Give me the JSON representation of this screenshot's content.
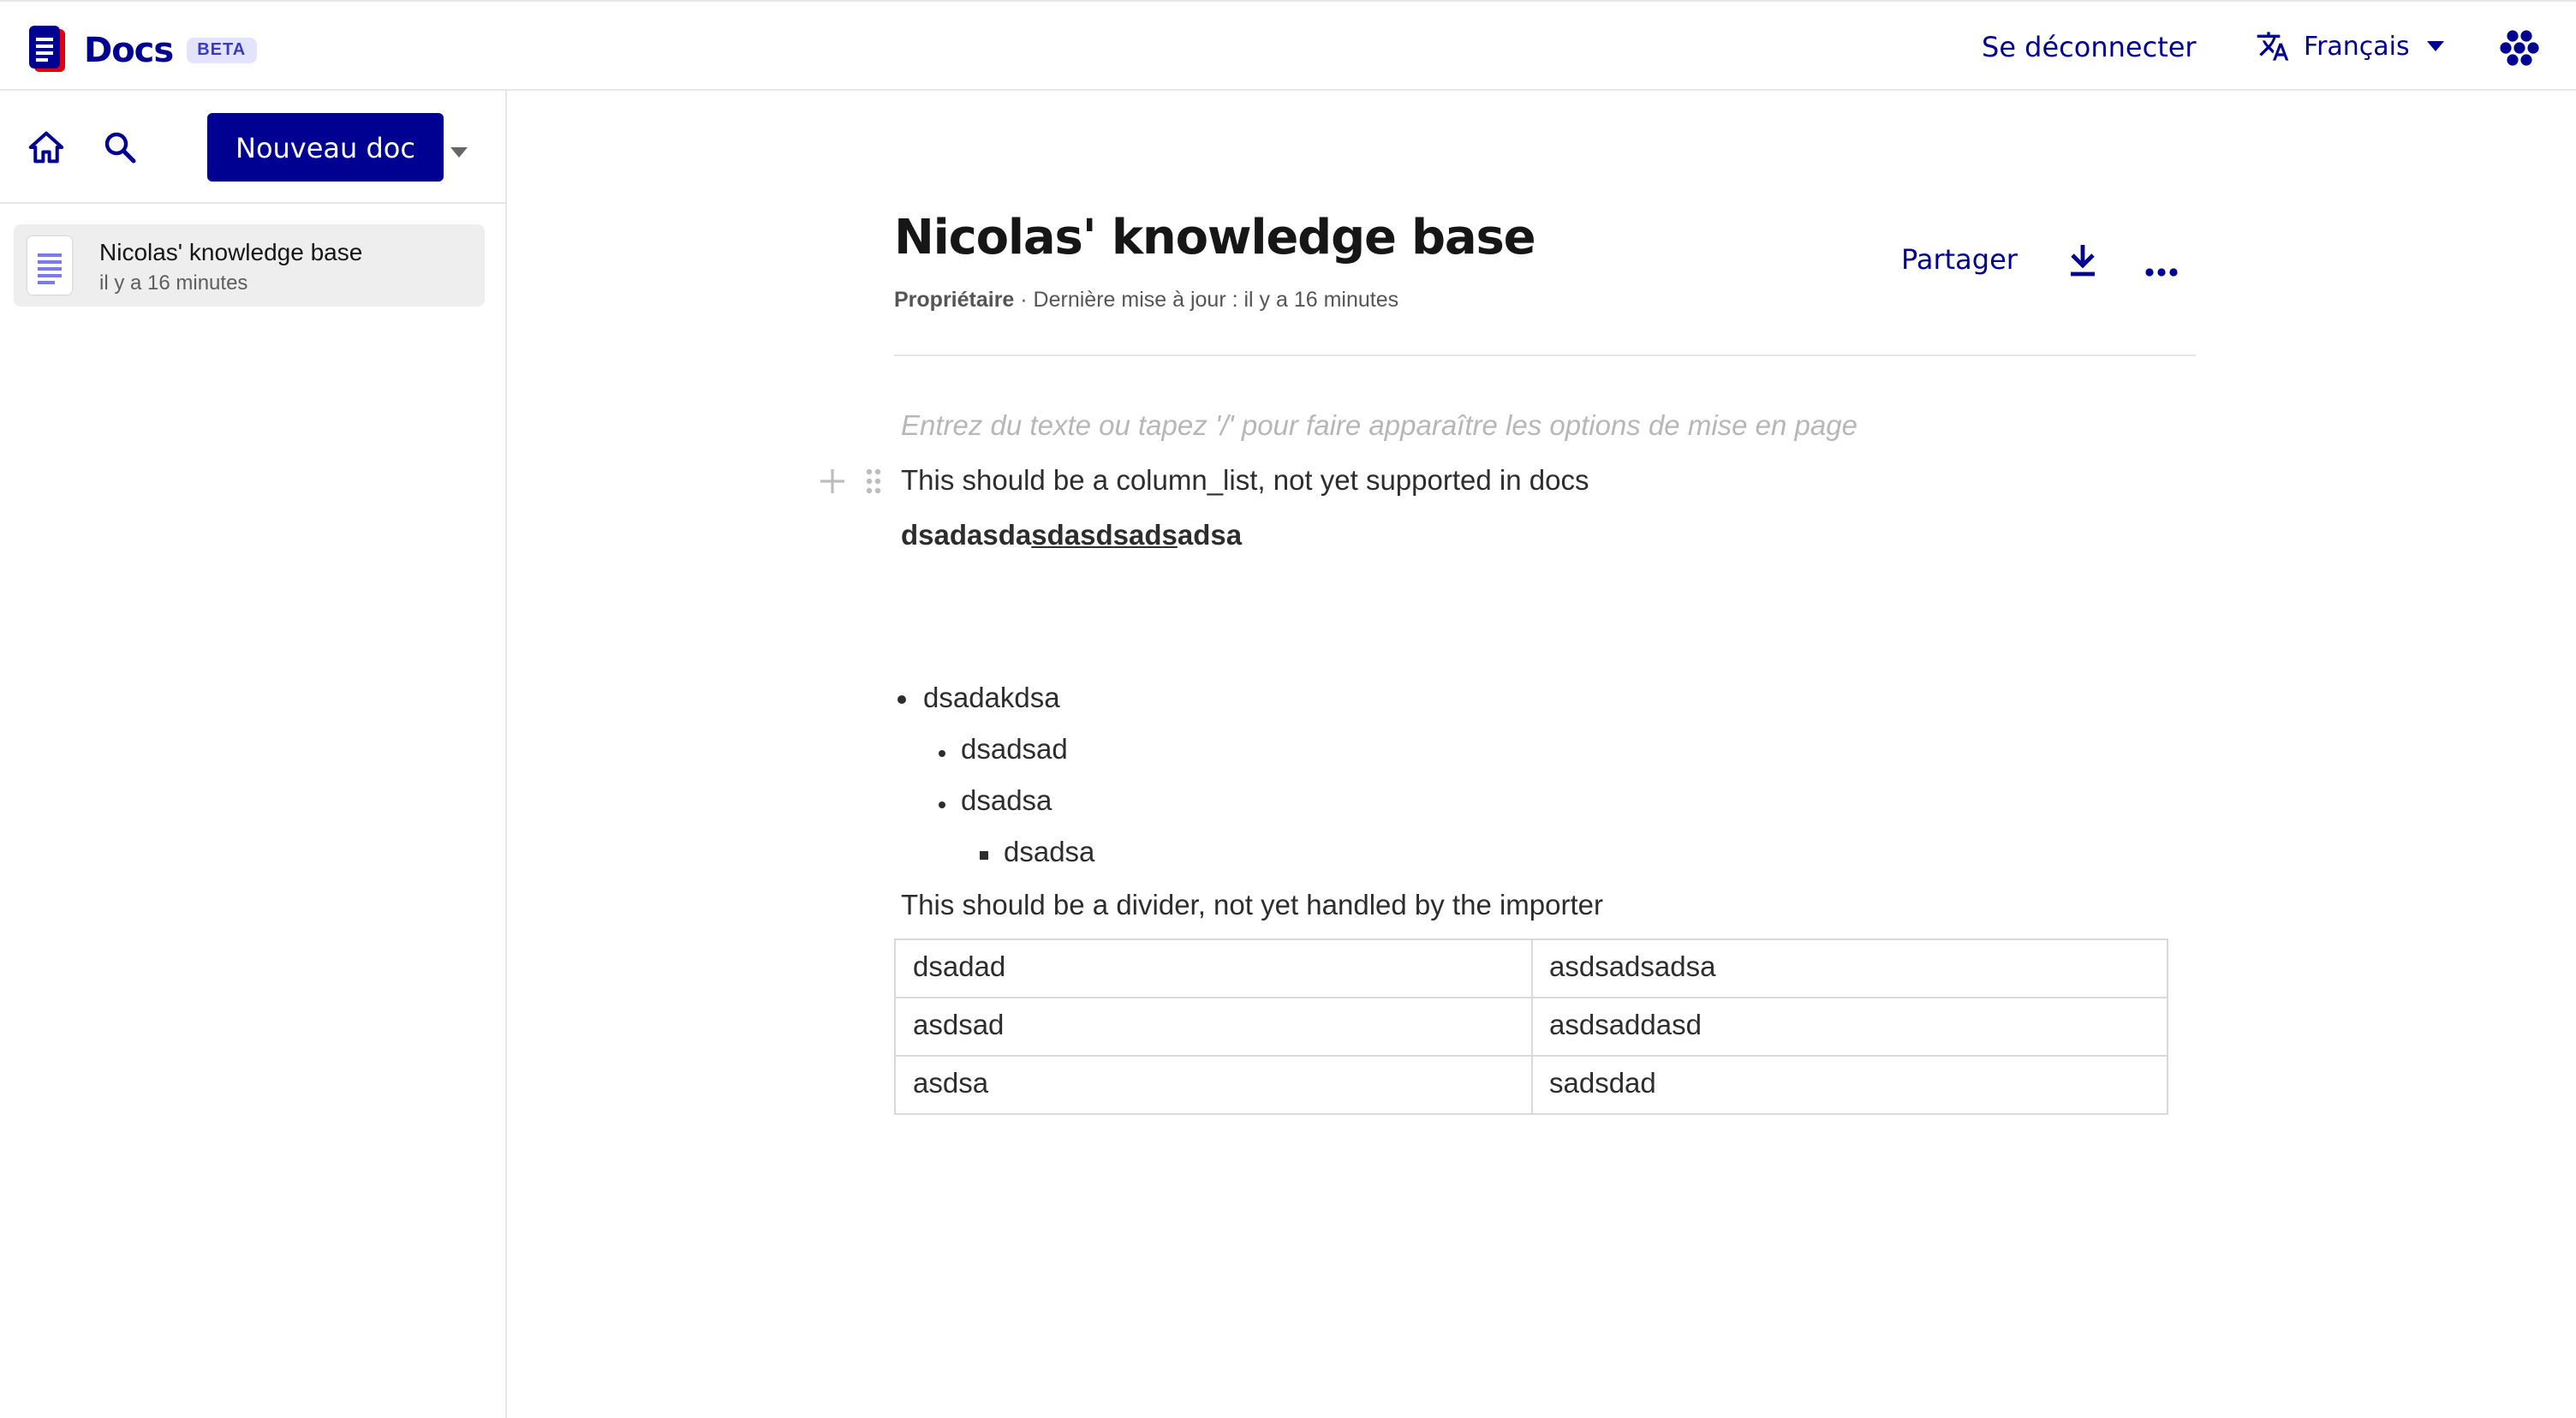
{
  "header": {
    "app_name": "Docs",
    "badge": "BETA",
    "logout": "Se déconnecter",
    "language": "Français",
    "brand_color": "#000091"
  },
  "sidebar": {
    "new_doc": "Nouveau doc",
    "docs": [
      {
        "title": "Nicolas' knowledge base",
        "updated": "il y a 16 minutes"
      }
    ]
  },
  "document": {
    "title": "Nicolas' knowledge base",
    "role": "Propriétaire",
    "updated_prefix": " · Dernière mise à jour : il y a 16 minutes",
    "share": "Partager",
    "placeholder": "Entrez du texte ou tapez '/' pour faire apparaître les options de mise en page",
    "paragraph1": "This should be a column_list, not yet supported in docs",
    "bold_line": {
      "part1": "dsadasda",
      "underlined": "sdasdsads",
      "part2": "adsa"
    },
    "bullets": [
      {
        "text": "dsadakdsa",
        "level": 1
      },
      {
        "text": "dsadsad",
        "level": 2
      },
      {
        "text": "dsadsa",
        "level": 2
      },
      {
        "text": "dsadsa",
        "level": 3
      }
    ],
    "paragraph2": "This should be a divider, not yet handled by the importer",
    "table": [
      [
        "dsadad",
        "asdsadsadsa"
      ],
      [
        "asdsad",
        "asdsaddasd"
      ],
      [
        "asdsa",
        "sadsdad"
      ]
    ]
  }
}
